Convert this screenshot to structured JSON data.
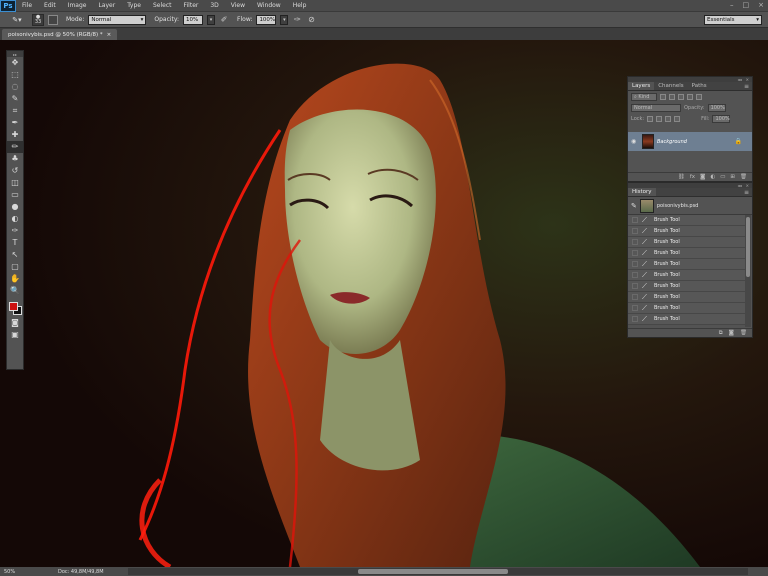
{
  "app": {
    "logo": "Ps"
  },
  "menu": [
    "File",
    "Edit",
    "Image",
    "Layer",
    "Type",
    "Select",
    "Filter",
    "3D",
    "View",
    "Window",
    "Help"
  ],
  "window_controls": {
    "minimize": "–",
    "maximize": "□",
    "close": "×"
  },
  "options_bar": {
    "brush_size": "33",
    "mode_label": "Mode:",
    "mode_value": "Normal",
    "opacity_label": "Opacity:",
    "opacity_value": "10%",
    "flow_label": "Flow:",
    "flow_value": "100%",
    "workspace": "Essentials"
  },
  "document": {
    "tab_title": "poisonivybis.psd @ 50% (RGB/8) *",
    "tab_close": "×"
  },
  "toolbox": {
    "tools": [
      "move-tool",
      "marquee-tool",
      "lasso-tool",
      "quick-select-tool",
      "crop-tool",
      "eyedropper-tool",
      "healing-tool",
      "brush-tool",
      "clone-stamp-tool",
      "history-brush-tool",
      "eraser-tool",
      "gradient-tool",
      "blur-tool",
      "dodge-tool",
      "pen-tool",
      "type-tool",
      "path-select-tool",
      "shape-tool",
      "hand-tool",
      "zoom-tool"
    ],
    "glyphs": [
      "✥",
      "⬚",
      "◌",
      "✎",
      "⌗",
      "✒",
      "✚",
      "✏",
      "♣",
      "↺",
      "◫",
      "▭",
      "●",
      "◐",
      "✑",
      "T",
      "↖",
      "▢",
      "✋",
      "🔍"
    ],
    "active_index": 7,
    "foreground_color": "#cc1010",
    "background_color": "#111111"
  },
  "layers_panel": {
    "tabs": [
      "Layers",
      "Channels",
      "Paths"
    ],
    "kind_label": "Kind",
    "blend_mode": "Normal",
    "opacity_label": "Opacity:",
    "opacity_value": "100%",
    "lock_label": "Lock:",
    "fill_label": "Fill:",
    "fill_value": "100%",
    "layer_name": "Background",
    "footer_icons": [
      "⛓",
      "fx",
      "◙",
      "◐",
      "▭",
      "⊞",
      "🗑"
    ]
  },
  "history_panel": {
    "title": "History",
    "snapshot_name": "poisonivybis.psd",
    "items": [
      "Brush Tool",
      "Brush Tool",
      "Brush Tool",
      "Brush Tool",
      "Brush Tool",
      "Brush Tool",
      "Brush Tool",
      "Brush Tool",
      "Brush Tool",
      "Brush Tool"
    ],
    "footer_icons": [
      "⧉",
      "◙",
      "🗑"
    ]
  },
  "status_bar": {
    "zoom": "50%",
    "doc_info": "Doc: 49,8M/49,8M",
    "arrow": "▶"
  }
}
